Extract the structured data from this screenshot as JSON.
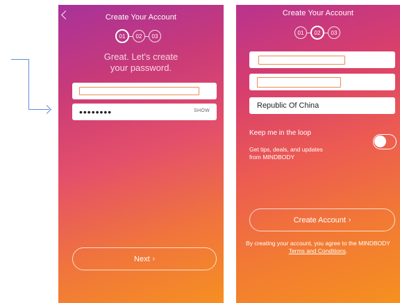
{
  "left_screen": {
    "title": "Create Your Account",
    "steps": [
      "01",
      "02",
      "03"
    ],
    "active_step": 1,
    "subtitle": "Great. Let's create\nyour password.",
    "password_mask": "••••••••",
    "show_label": "SHOW",
    "next_label": "Next",
    "next_icon": "chevron-right-icon"
  },
  "right_screen": {
    "title": "Create Your Account",
    "steps": [
      "01",
      "02",
      "03"
    ],
    "active_step": 2,
    "country": "Republic Of China",
    "loop_label": "Keep me in the loop",
    "tips_text": "Get tips, deals, and updates\nfrom MINDBODY",
    "toggle_state": "off",
    "create_label": "Create Account",
    "legal_prefix": "By creating your account, you agree to the MINDBODY ",
    "legal_link": "Terms and Conditions",
    "legal_suffix": "."
  },
  "colors": {
    "gradient_start": "#a8329a",
    "gradient_end": "#f68f22",
    "arrow": "#5b8ed6",
    "redaction_outline": "#f1894f"
  }
}
